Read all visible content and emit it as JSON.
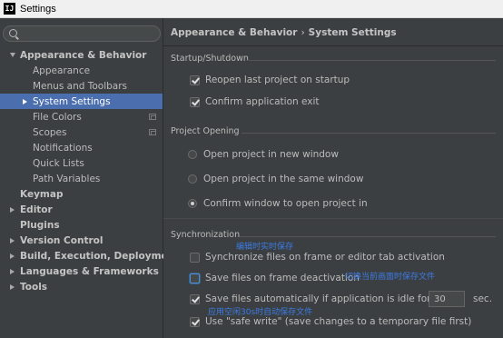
{
  "window": {
    "title": "Settings",
    "icon_text": "IJ"
  },
  "search": {
    "placeholder": "",
    "value": ""
  },
  "sidebar": {
    "items": [
      {
        "label": "Appearance & Behavior",
        "expanded": true
      },
      {
        "label": "Appearance"
      },
      {
        "label": "Menus and Toolbars"
      },
      {
        "label": "System Settings",
        "selected": true
      },
      {
        "label": "File Colors"
      },
      {
        "label": "Scopes"
      },
      {
        "label": "Notifications"
      },
      {
        "label": "Quick Lists"
      },
      {
        "label": "Path Variables"
      },
      {
        "label": "Keymap"
      },
      {
        "label": "Editor"
      },
      {
        "label": "Plugins"
      },
      {
        "label": "Version Control"
      },
      {
        "label": "Build, Execution, Deployment"
      },
      {
        "label": "Languages & Frameworks"
      },
      {
        "label": "Tools"
      }
    ]
  },
  "breadcrumb": {
    "parent": "Appearance & Behavior",
    "separator": "›",
    "current": "System Settings"
  },
  "startup": {
    "title": "Startup/Shutdown",
    "reopen_label": "Reopen last project on startup",
    "reopen_checked": true,
    "confirm_exit_label": "Confirm application exit",
    "confirm_exit_checked": true
  },
  "project_opening": {
    "title": "Project Opening",
    "options": [
      {
        "label": "Open project in new window",
        "selected": false
      },
      {
        "label": "Open project in the same window",
        "selected": false
      },
      {
        "label": "Confirm window to open project in",
        "selected": true
      }
    ]
  },
  "synchronization": {
    "title": "Synchronization",
    "sync_files_label": "Synchronize files on frame or editor tab activation",
    "sync_files_checked": false,
    "save_deactivation_label": "Save files on frame deactivation",
    "save_deactivation_checked": false,
    "save_idle_label": "Save files automatically if application is idle for",
    "save_idle_checked": true,
    "idle_value": "30",
    "idle_unit": "sec.",
    "safe_write_label": "Use \"safe write\" (save changes to a temporary file first)",
    "safe_write_checked": true
  },
  "annotations": {
    "note1": "编辑时实时保存",
    "note2": "切换当前画面时保存文件",
    "note3": "应用空闲30s时自动保存文件"
  },
  "colors": {
    "selection": "#4b6eaf",
    "annotation": "#3b7be4",
    "background": "#3c3f41"
  }
}
